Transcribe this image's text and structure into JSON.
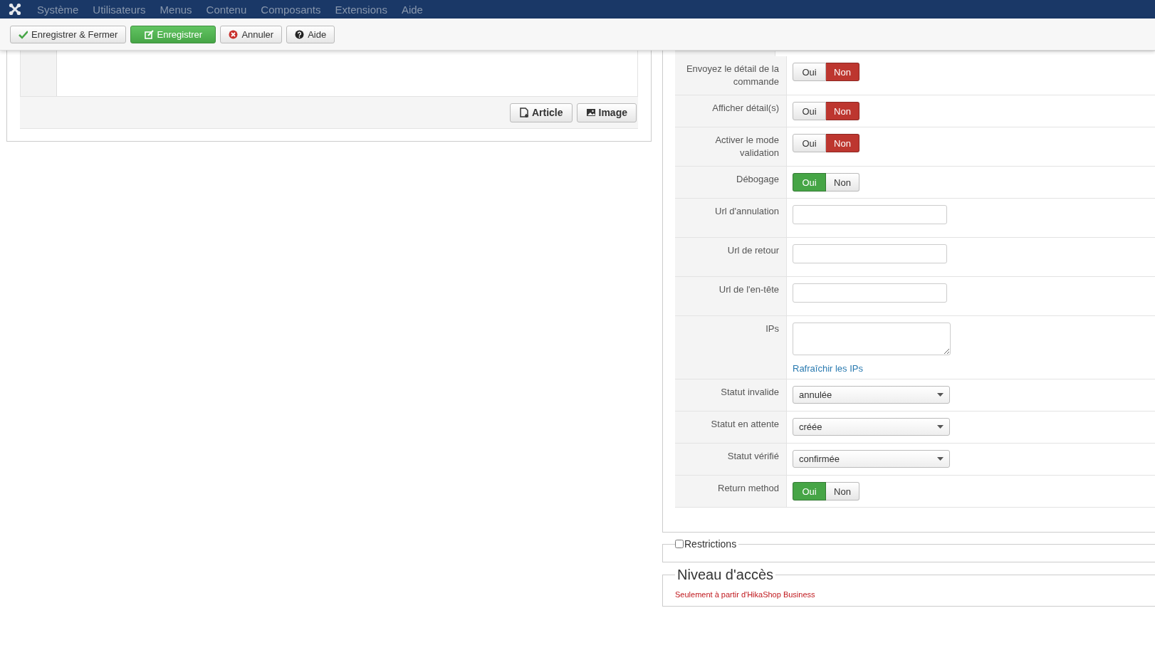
{
  "menu": {
    "items": [
      "Système",
      "Utilisateurs",
      "Menus",
      "Contenu",
      "Composants",
      "Extensions",
      "Aide"
    ]
  },
  "toolbar": {
    "buttons": [
      {
        "label": "Enregistrer & Fermer",
        "kind": "save-close"
      },
      {
        "label": "Enregistrer",
        "kind": "save"
      },
      {
        "label": "Annuler",
        "kind": "cancel"
      },
      {
        "label": "Aide",
        "kind": "help"
      }
    ]
  },
  "editor": {
    "buttons": [
      {
        "label": "Article",
        "kind": "article"
      },
      {
        "label": "Image",
        "kind": "image"
      }
    ]
  },
  "settings": {
    "rows": [
      {
        "kind": "toggle",
        "label": "Envoyez le détail de la commande",
        "options": [
          {
            "label": "Oui",
            "selected": false
          },
          {
            "label": "Non",
            "selected": true
          }
        ]
      },
      {
        "kind": "toggle",
        "label": "Afficher détail(s)",
        "options": [
          {
            "label": "Oui",
            "selected": false
          },
          {
            "label": "Non",
            "selected": true
          }
        ]
      },
      {
        "kind": "toggle",
        "label": "Activer le mode validation",
        "options": [
          {
            "label": "Oui",
            "selected": false
          },
          {
            "label": "Non",
            "selected": true
          }
        ]
      },
      {
        "kind": "toggle",
        "label": "Débogage",
        "options": [
          {
            "label": "Oui",
            "selected": true
          },
          {
            "label": "Non",
            "selected": false
          }
        ]
      },
      {
        "kind": "text",
        "label": "Url d'annulation"
      },
      {
        "kind": "text",
        "label": "Url de retour"
      },
      {
        "kind": "text",
        "label": "Url de l'en-tête"
      },
      {
        "kind": "textarea",
        "label": "IPs",
        "link": "Rafraîchir les IPs"
      },
      {
        "kind": "select",
        "label": "Statut invalide",
        "value": "annulée"
      },
      {
        "kind": "select",
        "label": "Statut en attente",
        "value": "créée"
      },
      {
        "kind": "select",
        "label": "Statut vérifié",
        "value": "confirmée"
      },
      {
        "kind": "toggle",
        "label": "Return method",
        "options": [
          {
            "label": "Oui",
            "selected": true
          },
          {
            "label": "Non",
            "selected": false
          }
        ]
      }
    ]
  },
  "restrictions": {
    "label": "Restrictions",
    "checked": false
  },
  "access": {
    "title": "Niveau d'accès",
    "note": "Seulement à partir d'HikaShop Business"
  }
}
